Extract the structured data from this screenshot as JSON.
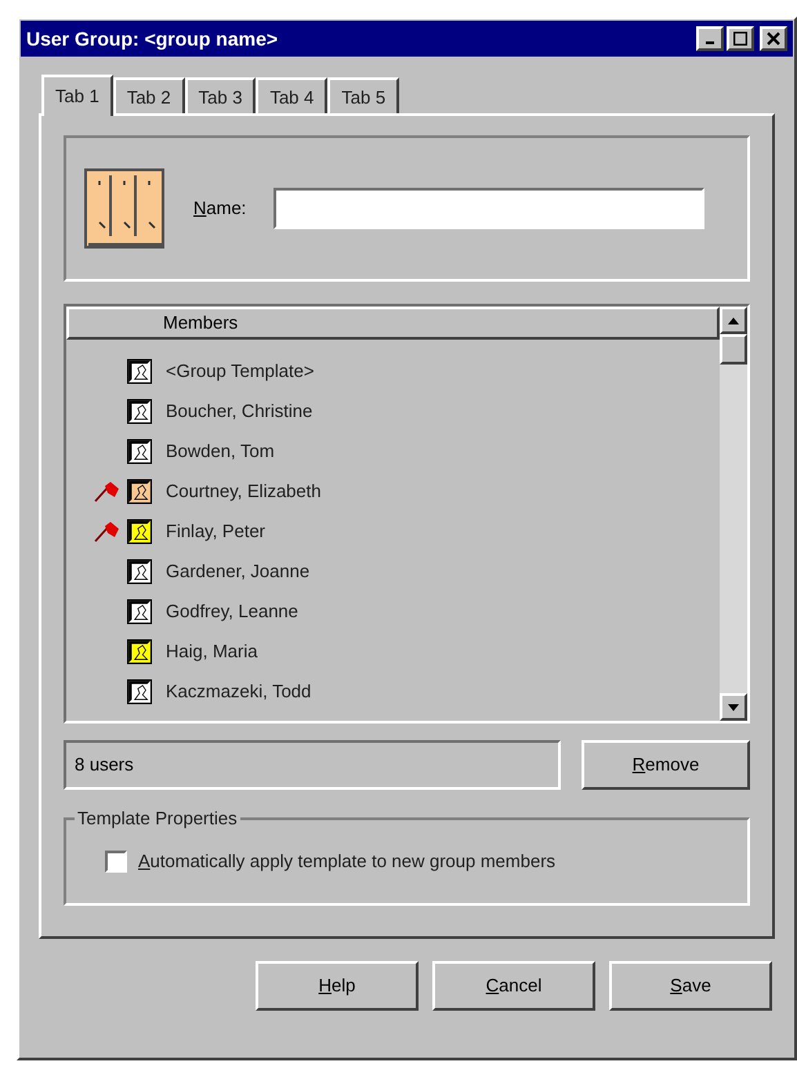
{
  "window": {
    "title": "User Group: <group name>"
  },
  "tabs": [
    {
      "label": "Tab 1",
      "selected": true
    },
    {
      "label": "Tab 2",
      "selected": false
    },
    {
      "label": "Tab 3",
      "selected": false
    },
    {
      "label": "Tab 4",
      "selected": false
    },
    {
      "label": "Tab 5",
      "selected": false
    }
  ],
  "name_field": {
    "label": "Name:",
    "underline_first": true
  },
  "members": {
    "header": "Members",
    "items": [
      {
        "name": "<Group Template>",
        "color": "#ffffff",
        "flagged": false
      },
      {
        "name": "Boucher, Christine",
        "color": "#ffffff",
        "flagged": false
      },
      {
        "name": "Bowden, Tom",
        "color": "#ffffff",
        "flagged": false
      },
      {
        "name": "Courtney, Elizabeth",
        "color": "#f8c890",
        "flagged": true
      },
      {
        "name": "Finlay, Peter",
        "color": "#ffff00",
        "flagged": true
      },
      {
        "name": "Gardener, Joanne",
        "color": "#ffffff",
        "flagged": false
      },
      {
        "name": "Godfrey, Leanne",
        "color": "#ffffff",
        "flagged": false
      },
      {
        "name": "Haig, Maria",
        "color": "#ffff00",
        "flagged": false
      },
      {
        "name": "Kaczmazeki, Todd",
        "color": "#ffffff",
        "flagged": false
      }
    ]
  },
  "status": "8 users",
  "remove_button": {
    "label": "Remove",
    "underline_first": true
  },
  "template_properties": {
    "title": "Template Properties",
    "checkbox": {
      "label": "Automatically apply template to new group members",
      "underline_first": true,
      "checked": false
    }
  },
  "buttons": [
    {
      "label": "Help",
      "underline_first": true
    },
    {
      "label": "Cancel",
      "underline_first": true
    },
    {
      "label": "Save",
      "underline_first": true
    }
  ]
}
